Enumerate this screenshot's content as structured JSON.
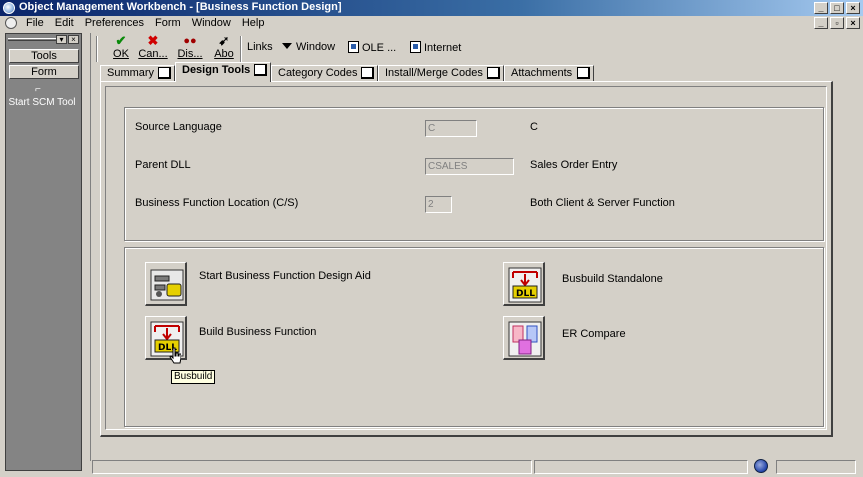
{
  "window": {
    "title": "Object Management Workbench - [Business Function Design]",
    "controls": [
      "_",
      "□",
      "×"
    ]
  },
  "menubar": {
    "items": [
      "File",
      "Edit",
      "Preferences",
      "Form",
      "Window",
      "Help"
    ],
    "controls": [
      "_",
      "▫",
      "×"
    ]
  },
  "left_panel": {
    "tools_label": "Tools",
    "form_label": "Form",
    "scm_label": "Start SCM Tool"
  },
  "toolbar": {
    "ok_label": "OK",
    "cancel_label": "Can...",
    "display_label": "Dis...",
    "about_label": "Abo",
    "links_label": "Links",
    "window_label": "Window",
    "ole_label": "OLE ...",
    "internet_label": "Internet"
  },
  "tabs": [
    {
      "label": "Summary"
    },
    {
      "label": "Design Tools"
    },
    {
      "label": "Category Codes"
    },
    {
      "label": "Install/Merge Codes"
    },
    {
      "label": "Attachments"
    }
  ],
  "fields": {
    "source_language": {
      "label": "Source Language",
      "value": "C",
      "description": "C"
    },
    "parent_dll": {
      "label": "Parent DLL",
      "value": "CSALES",
      "description": "Sales Order Entry"
    },
    "bf_location": {
      "label": "Business Function Location (C/S)",
      "value": "2",
      "description": "Both Client & Server Function"
    }
  },
  "actions": {
    "design_aid": "Start Business Function Design Aid",
    "build_bf": "Build Business Function",
    "busbuild_standalone": "Busbuild Standalone",
    "er_compare": "ER Compare"
  },
  "tooltip": "Busbuild"
}
